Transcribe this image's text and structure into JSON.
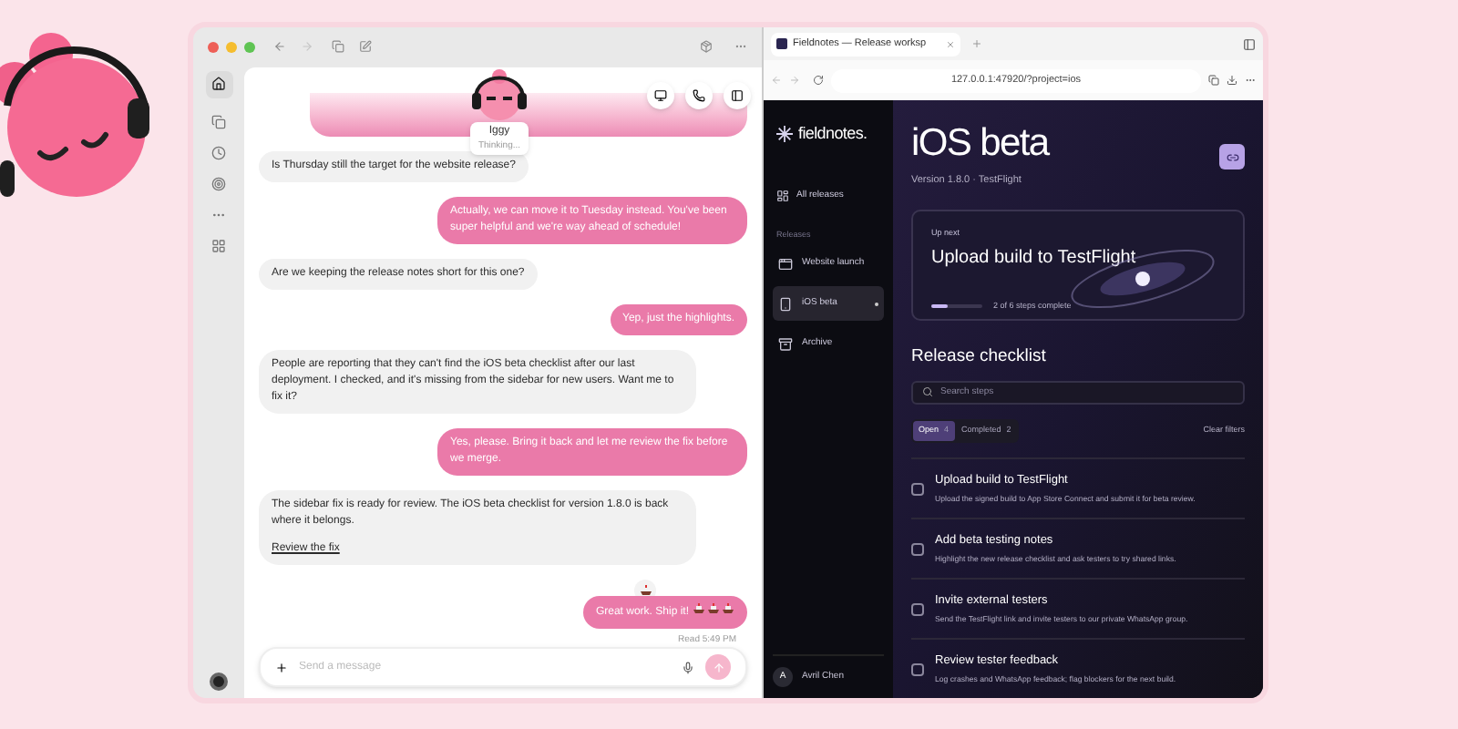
{
  "chat": {
    "agent": {
      "name": "Iggy",
      "status": "Thinking..."
    },
    "messages": [
      {
        "kind": "incoming",
        "text": "Is Thursday still the target for the website release?"
      },
      {
        "kind": "outgoing",
        "text": "Actually, we can move it to Tuesday instead. You've been super helpful and we're way ahead of schedule!"
      },
      {
        "kind": "incoming",
        "text": "Are we keeping the release notes short for this one?"
      },
      {
        "kind": "outgoing",
        "text": "Yep, just the highlights."
      },
      {
        "kind": "incoming",
        "text": "People are reporting that they can't find the iOS beta checklist after our last deployment. I checked, and it's missing from the sidebar for new users. Want me to fix it?"
      },
      {
        "kind": "outgoing",
        "text": "Yes, please. Bring it back and let me review the fix before we merge."
      },
      {
        "kind": "incoming",
        "text": "The sidebar fix is ready for review. The iOS beta checklist for version 1.8.0 is back where it belongs.",
        "link": "Review the fix"
      },
      {
        "kind": "outgoing",
        "text": "Great work. Ship it!",
        "reaction": true
      }
    ],
    "read_receipt": "Read 5:49 PM",
    "composer": {
      "placeholder": "Send a message"
    }
  },
  "browser": {
    "tab_title": "Fieldnotes — Release worksp",
    "url": "127.0.0.1:47920/?project=ios"
  },
  "app": {
    "logo": "fieldnotes.",
    "nav": [
      {
        "label": "All releases",
        "selected": false
      }
    ],
    "section_label": "Releases",
    "releases": [
      {
        "label": "Website launch",
        "kind": "window",
        "selected": false
      },
      {
        "label": "iOS beta",
        "kind": "phone",
        "selected": true
      },
      {
        "label": "Archive",
        "kind": "archive",
        "selected": false
      }
    ],
    "user": {
      "initial": "A",
      "name": "Avril Chen"
    },
    "title": "iOS beta",
    "subtitle": "Version 1.8.0 · TestFlight",
    "up_next": {
      "label": "Up next",
      "title": "Upload build to TestFlight",
      "level": 0.33,
      "progress_text": "2 of 6 steps complete"
    },
    "checklist": {
      "title": "Release checklist",
      "search_placeholder": "Search steps",
      "filters": [
        {
          "label": "Open",
          "count": "4",
          "selected": true
        },
        {
          "label": "Completed",
          "count": "2",
          "selected": false
        }
      ],
      "clear": "Clear filters",
      "steps": [
        {
          "title": "Upload build to TestFlight",
          "description": "Upload the signed build to App Store Connect and submit it for beta review.",
          "checked": false
        },
        {
          "title": "Add beta testing notes",
          "description": "Highlight the new release checklist and ask testers to try shared links.",
          "checked": false
        },
        {
          "title": "Invite external testers",
          "description": "Send the TestFlight link and invite testers to our private WhatsApp group.",
          "checked": false
        },
        {
          "title": "Review tester feedback",
          "description": "Log crashes and WhatsApp feedback; flag blockers for the next build.",
          "checked": false
        }
      ]
    }
  }
}
